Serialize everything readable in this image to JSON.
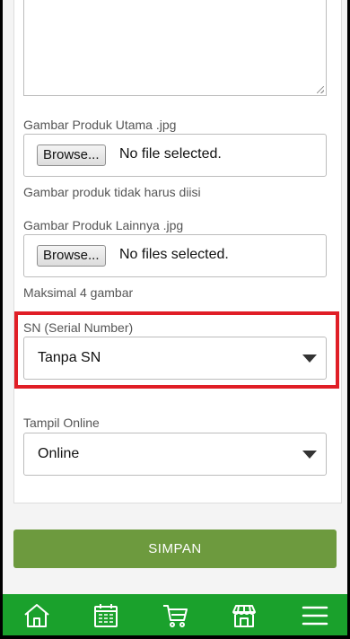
{
  "form": {
    "main_image": {
      "label": "Gambar Produk Utama .jpg",
      "browse_label": "Browse...",
      "status": "No file selected.",
      "hint": "Gambar produk tidak harus diisi"
    },
    "other_images": {
      "label": "Gambar Produk Lainnya .jpg",
      "browse_label": "Browse...",
      "status": "No files selected.",
      "hint": "Maksimal 4 gambar"
    },
    "serial_number": {
      "label": "SN (Serial Number)",
      "value": "Tanpa SN"
    },
    "online": {
      "label": "Tampil Online",
      "value": "Online"
    },
    "save_label": "SIMPAN"
  },
  "colors": {
    "accent_green": "#6d9a3e",
    "nav_green": "#1aa12c",
    "highlight_red": "#e01e26"
  },
  "bottom_nav": {
    "items": [
      {
        "icon": "home-icon"
      },
      {
        "icon": "calendar-icon"
      },
      {
        "icon": "cart-icon"
      },
      {
        "icon": "store-icon"
      },
      {
        "icon": "menu-icon"
      }
    ]
  }
}
